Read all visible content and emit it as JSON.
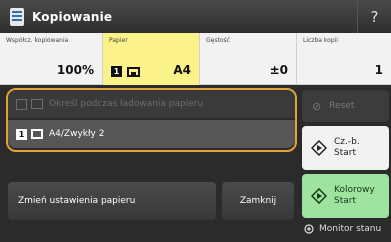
{
  "titlebar": {
    "title": "Kopiowanie",
    "help_label": "?"
  },
  "status": {
    "scale_label": "Współcz. kopiowania",
    "scale_value": "100%",
    "paper_label": "Papier",
    "paper_drawer": "1",
    "paper_value": "A4",
    "density_label": "Gęstość",
    "density_value": "±0",
    "copies_label": "Liczba kopii",
    "copies_value": "1"
  },
  "paper_list": {
    "option1": "Określ podczas ładowania papieru",
    "option2_drawer": "1",
    "option2": "A4/Zwykły 2"
  },
  "buttons": {
    "change_paper": "Zmień ustawienia papieru",
    "close": "Zamknij",
    "reset": "Reset",
    "bw_start_line1": "Cz.-b.",
    "bw_start_line2": "Start",
    "color_start_line1": "Kolorowy",
    "color_start_line2": "Start",
    "status_monitor": "Monitor stanu"
  },
  "colors": {
    "accent_selection": "#e2a23a",
    "highlight_paper": "#fbf28a",
    "color_start": "#9fe3a0"
  }
}
